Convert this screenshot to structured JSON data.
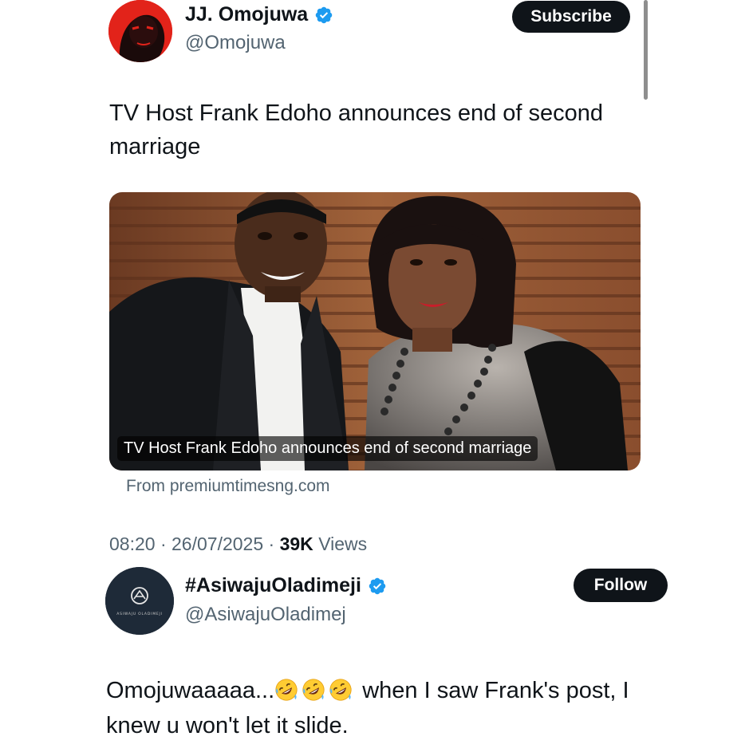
{
  "tweet1": {
    "author_name": "JJ. Omojuwa",
    "author_handle": "@Omojuwa",
    "subscribe_label": "Subscribe",
    "text": "TV Host Frank Edoho announces end of second marriage",
    "card": {
      "caption": "TV Host Frank Edoho announces end of second marriage",
      "source": "From premiumtimesng.com"
    },
    "time": "08:20",
    "date": "26/07/2025",
    "views_count": "39K",
    "views_label": "Views"
  },
  "tweet2": {
    "author_name": "#AsiwajuOladimeji",
    "author_handle": "@AsiwajuOladimej",
    "follow_label": "Follow",
    "text_start": "Omojuwaaaaa...",
    "emoji_name": "rolling-on-floor-laughing",
    "emoji_count": 3,
    "text_end": " when I saw Frank's post, I knew u won't let it slide.",
    "avatar_logo_text": "ASIWAJU OLADIMEJI"
  },
  "colors": {
    "primary_text": "#0f1419",
    "secondary_text": "#536471",
    "verified_blue": "#1d9bf0",
    "button_bg": "#0f1419"
  }
}
